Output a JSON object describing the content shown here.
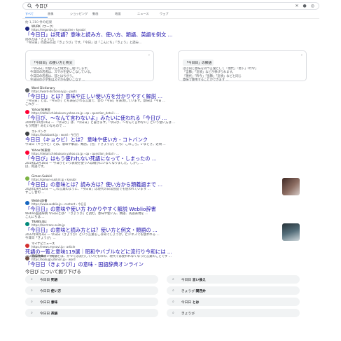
{
  "search": {
    "query": "今日び"
  },
  "tabs": [
    "すべて",
    "画像",
    "ショッピング",
    "動画",
    "地図",
    "ニュース",
    "ウェブ"
  ],
  "result_stats": "約 1,310 件の結果",
  "results": [
    {
      "site_name": "WURK（ワーク）",
      "site_url": "https://ergonbu.jp › magazine › kyoubi",
      "title": "「今日日」は死語？意味と読み方、使い方、類語、英語を例文 ...",
      "snippet": [
        "読み方は「きょうび」",
        "「今日日」の読み方は「きょうび」です。「今日」は「こんにち」「きょう」と読み..."
      ]
    },
    {
      "site_name": "Word Dictionary",
      "site_url": "https://word-dictionary.jp › posts",
      "title": "「今日日」とは？意味や正しい使い方を分かりやすく解説 ...",
      "snippet": [
        "「今日日」とは、「今日び」とも表記される言葉で、昔の「今日」を表現しています。意味は「今日 ...",
        "これが ..."
      ]
    },
    {
      "site_name": "Yahoo!知恵袋",
      "site_url": "https://detail.chiebukuro.yahoo.co.jp › qa › question_detail › ...",
      "title": "「今日び、〜なんて言わないよ」みたいに使われる「今日び ...",
      "snippet": [
        "2009年10月19日 — 「今日び」は、「今日日」と書きます。「今日び、〜なんて言わない」という使い方は ...",
        "もう死語？みたいなもので ..."
      ]
    },
    {
      "site_name": "コトバンク",
      "site_url": "https://kotobank.jp › word › 今日日",
      "title": "今日日（キョウビ）とは？ 意味や使い方 - コトバンク",
      "snippet": [
        "今日日（キョウビ）とは。意味や解説、類語。［名］（「きょうひ」とも）このごろ。いまどき。近頃 ..."
      ]
    },
    {
      "site_name": "Yahoo!知恵袋",
      "site_url": "https://detail.chiebukuro.yahoo.co.jp › qa › question_detail › ...",
      "title": "「今日び」はもう使われない死語になって・しまったの ...",
      "snippet": [
        "2019年2月16日 — 今日びという表現を使う人は確かに少なくなりました。しかし ...",
        "は、死語です。"
      ]
    },
    {
      "site_name": "Gimon-Sukkiri",
      "site_url": "https://gimon-sukkiri.jp › kyoubi",
      "title": "「今日日」の意味とは？読み方は？使い方から類義語まで ...",
      "snippet": [
        "2020年9月12日 — この言葉のように、「今日日」は現代の日常会話でも使われています ...",
        "すこし昔の ..."
      ]
    },
    {
      "site_name": "Weblio辞書",
      "site_url": "https://www.weblio.jp › content › 今日日",
      "title": "「今日日」の意味や使い方 わかりやすく解説 Weblio辞書",
      "snippet": [
        "Weblio国語辞典 今日日とは？「きょうび」と読む。意味や使い方、類語、英語表現を ...",
        "こんにちは ..."
      ]
    },
    {
      "site_name": "TRANS.Biz",
      "site_url": "https://biz.trans-suite.jp",
      "title": "「今日日」の意味と読み方とは？使い方と例文・類語の ...",
      "snippet": [
        "2022年8月3日 — 今日日（きょうび）という言葉をご存知でしょうか。ビジネスでも使われる ...",
        "今日日「きょうび」..."
      ]
    },
    {
      "site_name": "マイナビニュース",
      "site_url": "https://news.mynavi.jp › article",
      "title": "死語の一覧と意味119選｜昭和やバブルなどに流行り今和には ...",
      "snippet": [
        "2024年2月8日 — 死語とは、かつては流行していたものの、現代では使われなくなった言葉のことです ...",
        "死語 ..."
      ]
    },
    {
      "site_name": "国語辞典オンライン",
      "site_url": "https://kokugo.jitenon.jp › word",
      "title": "「今日日（きょうび）」の意味 - 国語辞典オンライン",
      "snippet": [
        "2019年10月8日 — 今日日（きょうび）の意味を解説しています。意味：このごろ、近頃、今どき ..."
      ]
    }
  ],
  "cards": [
    {
      "title": "「今日日」の使い方と例文",
      "lines": [
        "「今日日」の使い方と例文をご紹介します。",
        "今日日の若者は、スマホを使いこなしている。",
        "今日日の若者は、昔とはちがう。",
        "今日日の小学生はスマホも使いこなす ..."
      ]
    },
    {
      "title": "「今日日」の類語",
      "lines": [
        "ほぼ同じ意味を持つ言葉として「現代」「現下」「昨今」",
        "「当節」「近頃」などが挙げられます。",
        "「現代」「昨今」「当節」「近頃」などと同じ",
        "意味で使用することができます ..."
      ]
    }
  ],
  "related": {
    "title": "今日び について掘り下げる",
    "items": [
      {
        "base": "今日日",
        "bold": "死語"
      },
      {
        "base": "今日日",
        "bold": "言い換え"
      },
      {
        "base": "今日日",
        "bold": "使い方"
      },
      {
        "base": "きょうび",
        "bold": "関西弁"
      },
      {
        "base": "今日日",
        "bold": "意味"
      },
      {
        "base": "今日日",
        "bold": "とは"
      },
      {
        "base": "今日日",
        "bold": "英語"
      },
      {
        "base": "きょうび",
        "bold": ""
      }
    ]
  },
  "colors": {
    "link": "#1a0dab",
    "accent": "#1a73e8",
    "snippet": "#4d5156"
  }
}
